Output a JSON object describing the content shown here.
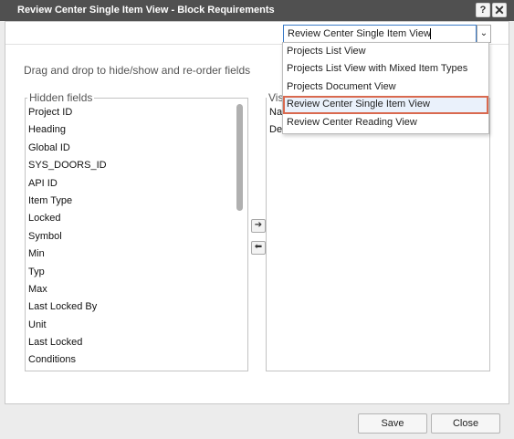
{
  "dialog": {
    "title": "Review Center Single Item View - Block Requirements",
    "help_label": "?",
    "close_label": "✕"
  },
  "view_select": {
    "value": "Review Center Single Item View",
    "arrow": "⌄",
    "options": [
      "Projects List View",
      "Projects List View with Mixed Item Types",
      "Projects Document View",
      "Review Center Single Item View",
      "Review Center Reading View"
    ],
    "highlighted_index": 3
  },
  "instructions": "Drag and drop to hide/show and re-order fields",
  "hidden_fields": {
    "legend": "Hidden fields",
    "items": [
      "Project ID",
      "Heading",
      "Global ID",
      "SYS_DOORS_ID",
      "API ID",
      "Item Type",
      "Locked",
      "Symbol",
      "Min",
      "Typ",
      "Max",
      "Last Locked By",
      "Unit",
      "Last Locked",
      "Conditions"
    ],
    "scrollbar_position": 0.0
  },
  "visible_fields": {
    "legend": "Vis",
    "items": [
      "Na",
      "De"
    ]
  },
  "move_buttons": {
    "right": "➔",
    "left": "⬅"
  },
  "footer": {
    "save_label": "Save",
    "close_label": "Close"
  },
  "colors": {
    "titlebar": "#505050",
    "select_border": "#3a7bc8",
    "highlight_outline": "#d9694f"
  }
}
